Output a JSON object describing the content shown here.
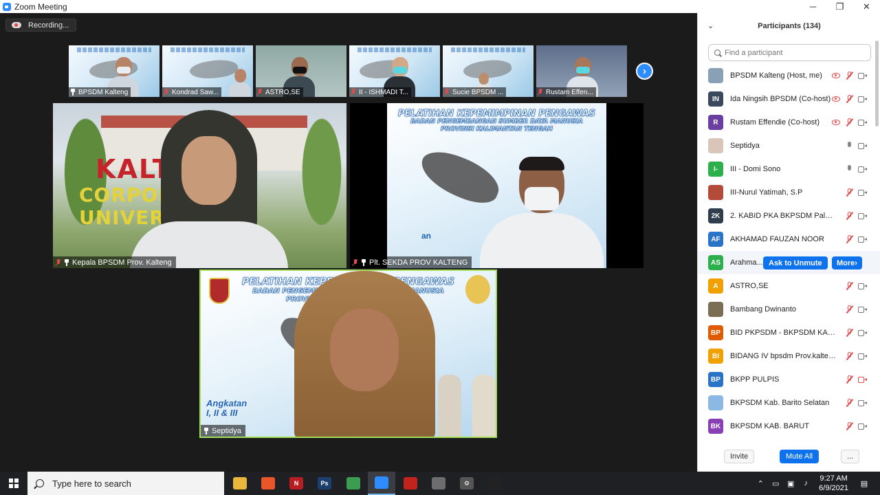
{
  "window": {
    "title": "Zoom Meeting",
    "controls": [
      "─",
      "❐",
      "✕"
    ]
  },
  "meeting": {
    "recording_label": "Recording...",
    "thumbnails": [
      {
        "name": "BPSDM Kalteng",
        "mic_muted": false
      },
      {
        "name": "Kondrad Saw...",
        "mic_muted": true
      },
      {
        "name": "ASTRO,SE",
        "mic_muted": true
      },
      {
        "name": "II - ISHMADI T...",
        "mic_muted": true
      },
      {
        "name": "Sucie BPSDM ...",
        "mic_muted": true
      },
      {
        "name": "Rustam Effen...",
        "mic_muted": true
      }
    ],
    "tiles": [
      {
        "name": "Kepala BPSDM Prov. Kalteng",
        "sign_line1": "KALTENG",
        "sign_line2": "CORPORATE UNIVERSITY"
      },
      {
        "name": "Plt. SEKDA PROV KALTENG",
        "slide_title": "PELATIHAN KEPEMIMPINAN PENGAWAS",
        "slide_line2": "BADAN PENGEMBANGAN SUMBER DAYA MANUSIA",
        "slide_line3": "PROVINSI KALIMANTAN TENGAH",
        "slide_fragment": "an"
      },
      {
        "name": "Septidya",
        "slide_title": "PELATIHAN KEPEMIMPINAN PENGAWAS",
        "slide_line2": "BADAN PENGEMBANGAN SUMBER DAYA MANUSIA",
        "slide_line3": "PROVINSI KALIMANTAN TENGAH",
        "angkatan_line1": "Angkatan",
        "angkatan_line2": "I, II & III"
      }
    ]
  },
  "participants": {
    "title": "Participants (134)",
    "search_placeholder": "Find a participant",
    "list": [
      {
        "name": "BPSDM Kalteng (Host, me)",
        "initials": "",
        "color": "#8aa1b5",
        "eye": true,
        "mic": "off",
        "cam": "on"
      },
      {
        "name": "Ida Ningsih BPSDM (Co-host)",
        "initials": "IN",
        "color": "#3a4a5c",
        "eye": true,
        "mic": "off",
        "cam": "on"
      },
      {
        "name": "Rustam Effendie (Co-host)",
        "initials": "R",
        "color": "#6b3fa0",
        "eye": true,
        "mic": "off",
        "cam": "on"
      },
      {
        "name": "Septidya",
        "initials": "",
        "color": "#d9c6b8",
        "eye": false,
        "mic": "on",
        "cam": "on"
      },
      {
        "name": "III - Domi Sono",
        "initials": "I-",
        "color": "#2db04b",
        "eye": false,
        "mic": "on",
        "cam": "on"
      },
      {
        "name": "III-Nurul Yatimah, S.P",
        "initials": "",
        "color": "#b44a3a",
        "eye": false,
        "mic": "off",
        "cam": "on"
      },
      {
        "name": "2. KABID PKA BKPSDM Palangka ...",
        "initials": "2K",
        "color": "#2f3d4c",
        "eye": false,
        "mic": "off",
        "cam": "on"
      },
      {
        "name": "AKHAMAD FAUZAN NOOR",
        "initials": "AF",
        "color": "#2a73c7",
        "eye": false,
        "mic": "off",
        "cam": "on"
      },
      {
        "name": "Arahma...",
        "initials": "AS",
        "color": "#2db04b",
        "eye": false,
        "mic": "off",
        "cam": "on",
        "highlight": true
      },
      {
        "name": "ASTRO,SE",
        "initials": "A",
        "color": "#f0a000",
        "eye": false,
        "mic": "off",
        "cam": "on"
      },
      {
        "name": "Bambang Dwinanto",
        "initials": "",
        "color": "#7a6f55",
        "eye": false,
        "mic": "off",
        "cam": "on"
      },
      {
        "name": "BID PKPSDM - BKPSDM KAB. BAR...",
        "initials": "BP",
        "color": "#e05a00",
        "eye": false,
        "mic": "off",
        "cam": "on"
      },
      {
        "name": "BIDANG IV bpsdm Prov.kalteng",
        "initials": "BI",
        "color": "#f0a000",
        "eye": false,
        "mic": "off",
        "cam": "on"
      },
      {
        "name": "BKPP PULPIS",
        "initials": "BP",
        "color": "#2a73c7",
        "eye": false,
        "mic": "off",
        "cam": "off"
      },
      {
        "name": "BKPSDM Kab. Barito Selatan",
        "initials": "",
        "color": "#8bb9e3",
        "eye": false,
        "mic": "off",
        "cam": "on"
      },
      {
        "name": "BKPSDM KAB. BARUT",
        "initials": "BK",
        "color": "#8a3fb5",
        "eye": false,
        "mic": "off",
        "cam": "on"
      }
    ],
    "ask_to_unmute": "Ask to Unmute",
    "more": "More",
    "footer": {
      "invite": "Invite",
      "mute_all": "Mute All",
      "overflow": "..."
    }
  },
  "taskbar": {
    "search_placeholder": "Type here to search",
    "apps": [
      {
        "icon": "file-explorer-icon",
        "label": "",
        "color": "#e8b73b"
      },
      {
        "icon": "firefox-icon",
        "label": "",
        "color": "#e8562a"
      },
      {
        "icon": "netflix-icon",
        "label": "N",
        "color": "#b81d24"
      },
      {
        "icon": "photoshop-icon",
        "label": "Ps",
        "color": "#1d3f6e"
      },
      {
        "icon": "chrome-icon",
        "label": "",
        "color": "#3a9d4f"
      },
      {
        "icon": "zoom-icon",
        "label": "",
        "color": "#2d8cff"
      },
      {
        "icon": "acrobat-icon",
        "label": "",
        "color": "#c4221c"
      },
      {
        "icon": "video-editor-icon",
        "label": "",
        "color": "#6d6d6d"
      },
      {
        "icon": "settings-icon",
        "label": "⚙",
        "color": "#555"
      },
      {
        "icon": "terminal-icon",
        "label": "",
        "color": "#222"
      }
    ],
    "time": "9:27 AM",
    "date": "6/9/2021"
  }
}
